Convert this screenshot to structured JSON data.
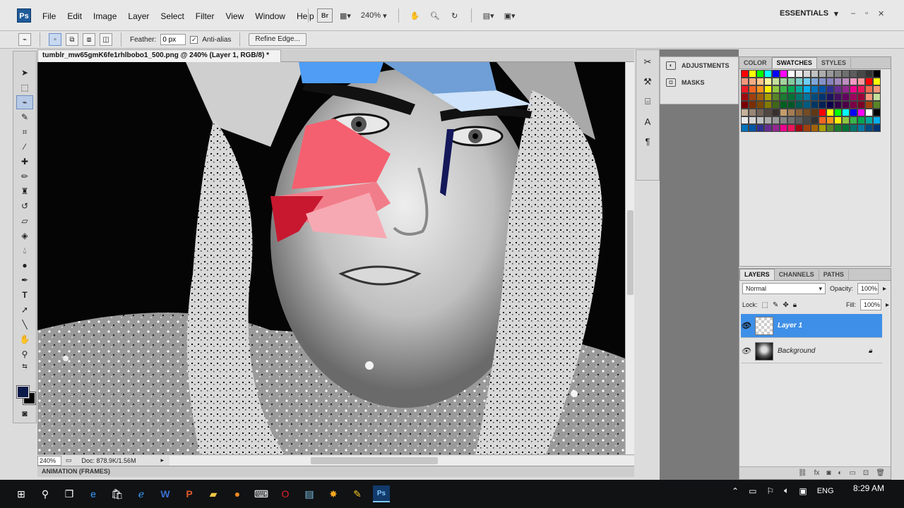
{
  "app": {
    "logo": "Ps",
    "menu": [
      "File",
      "Edit",
      "Image",
      "Layer",
      "Select",
      "Filter",
      "View",
      "Window",
      "Help"
    ],
    "app_bar": {
      "bridge": "Br",
      "zoom": "240%"
    },
    "workspace": "ESSENTIALS",
    "window_controls": [
      "–",
      "▫",
      "✕"
    ]
  },
  "options_bar": {
    "feather_label": "Feather:",
    "feather_value": "0 px",
    "antialias_label": "Anti-alias",
    "antialias_checked": "✓",
    "refine_edge_label": "Refine Edge..."
  },
  "document": {
    "tab_title": "tumblr_mw65gmK6fe1rhlbobo1_500.png @ 240% (Layer 1, RGB/8) *",
    "tab_close": "✕",
    "status_zoom": "240%",
    "status_doc": "Doc: 878.9K/1.56M",
    "animation_panel": "ANIMATION (FRAMES)"
  },
  "adjustments_panel": {
    "adjustments": "ADJUSTMENTS",
    "masks": "MASKS"
  },
  "swatches_panel": {
    "tabs": [
      "COLOR",
      "SWATCHES",
      "STYLES"
    ],
    "active_tab": "SWATCHES"
  },
  "layers_panel": {
    "tabs": [
      "LAYERS",
      "CHANNELS",
      "PATHS"
    ],
    "blend_mode": "Normal",
    "opacity_label": "Opacity:",
    "opacity_value": "100%",
    "lock_label": "Lock:",
    "fill_label": "Fill:",
    "fill_value": "100%",
    "layers": [
      {
        "name": "Layer 1",
        "selected": true
      },
      {
        "name": "Background",
        "selected": false
      }
    ]
  },
  "taskbar": {
    "language": "ENG",
    "time": "8:29 AM"
  },
  "colors": {
    "accent_selection": "#3e8fe7",
    "foreground_swatch": "#0c1a4a",
    "background_swatch": "#000000"
  }
}
